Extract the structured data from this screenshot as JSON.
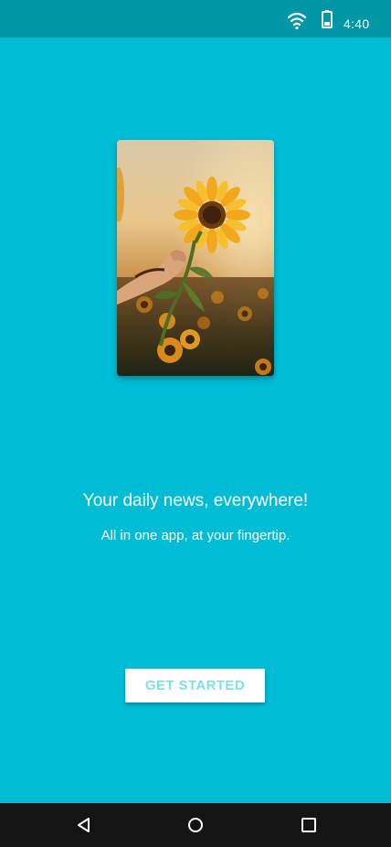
{
  "status_bar": {
    "time": "4:40",
    "wifi_icon": "wifi-icon",
    "battery_icon": "battery-icon"
  },
  "hero_image": {
    "subject": "hand holding a sunflower in a sunflower field at sunset"
  },
  "onboarding": {
    "headline": "Your daily news, everywhere!",
    "subheadline": "All in one app, at your fingertip.",
    "cta_label": "GET STARTED"
  },
  "nav_bar": {
    "back_icon": "back-icon",
    "home_icon": "home-icon",
    "recents_icon": "recents-icon"
  },
  "colors": {
    "background": "#00BCD4",
    "status_bar": "#0097A7",
    "cta_text": "#80DEEA",
    "nav_bar": "#141414"
  }
}
